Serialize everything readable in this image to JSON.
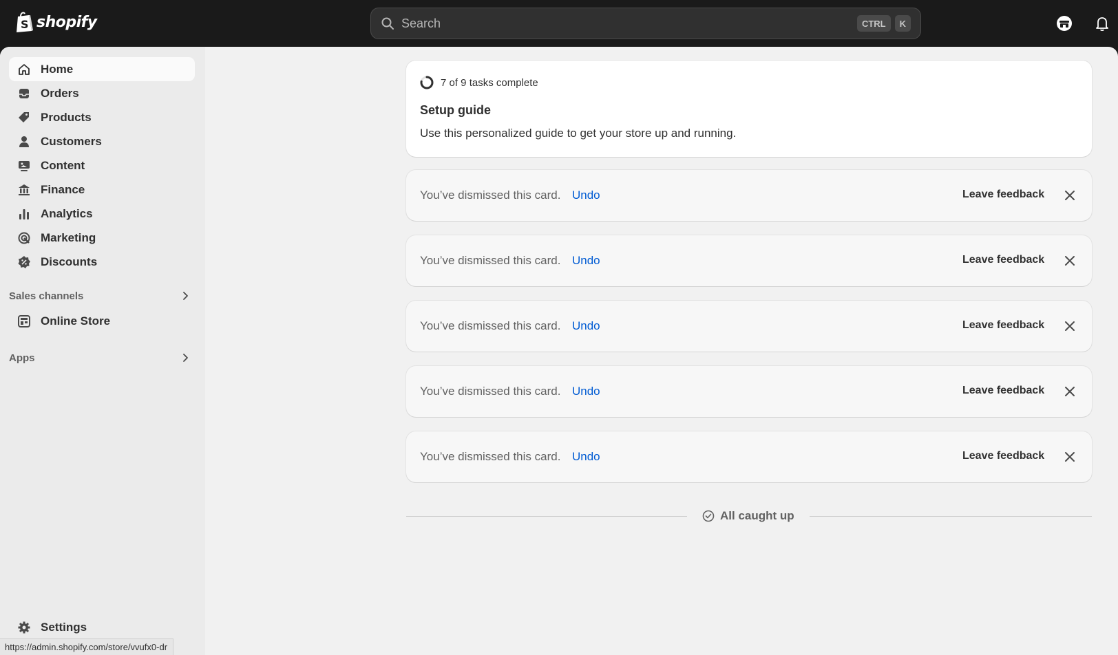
{
  "brand": {
    "name": "shopify",
    "color": "#95bf47"
  },
  "topbar": {
    "search_placeholder": "Search",
    "shortcut_keys": [
      "CTRL",
      "K"
    ],
    "icons": [
      "store-icon",
      "bell-icon"
    ]
  },
  "sidebar": {
    "items": [
      {
        "label": "Home",
        "icon": "home-icon",
        "active": true
      },
      {
        "label": "Orders",
        "icon": "inbox-icon",
        "active": false
      },
      {
        "label": "Products",
        "icon": "tag-icon",
        "active": false
      },
      {
        "label": "Customers",
        "icon": "person-icon",
        "active": false
      },
      {
        "label": "Content",
        "icon": "image-icon",
        "active": false
      },
      {
        "label": "Finance",
        "icon": "bank-icon",
        "active": false
      },
      {
        "label": "Analytics",
        "icon": "bar-chart-icon",
        "active": false
      },
      {
        "label": "Marketing",
        "icon": "target-icon",
        "active": false
      },
      {
        "label": "Discounts",
        "icon": "discount-icon",
        "active": false
      }
    ],
    "sales_channels": {
      "label": "Sales channels",
      "items": [
        {
          "label": "Online Store",
          "icon": "storefront-icon"
        }
      ]
    },
    "apps": {
      "label": "Apps"
    },
    "settings": {
      "label": "Settings",
      "icon": "gear-icon"
    }
  },
  "setup_guide": {
    "progress_text": "7 of 9 tasks complete",
    "tasks_complete": 7,
    "tasks_total": 9,
    "title": "Setup guide",
    "description": "Use this personalized guide to get your store up and running."
  },
  "dismissed_cards": [
    {
      "message": "You’ve dismissed this card.",
      "undo": "Undo",
      "feedback": "Leave feedback"
    },
    {
      "message": "You’ve dismissed this card.",
      "undo": "Undo",
      "feedback": "Leave feedback"
    },
    {
      "message": "You’ve dismissed this card.",
      "undo": "Undo",
      "feedback": "Leave feedback"
    },
    {
      "message": "You’ve dismissed this card.",
      "undo": "Undo",
      "feedback": "Leave feedback"
    },
    {
      "message": "You’ve dismissed this card.",
      "undo": "Undo",
      "feedback": "Leave feedback"
    }
  ],
  "footer": {
    "caught_up_text": "All caught up"
  },
  "status_bar": {
    "url": "https://admin.shopify.com/store/vvufx0-dr"
  },
  "colors": {
    "link": "#005bd3",
    "topbar": "#1a1a1a",
    "sidebar": "#ebebeb",
    "canvas": "#f1f1f1"
  }
}
